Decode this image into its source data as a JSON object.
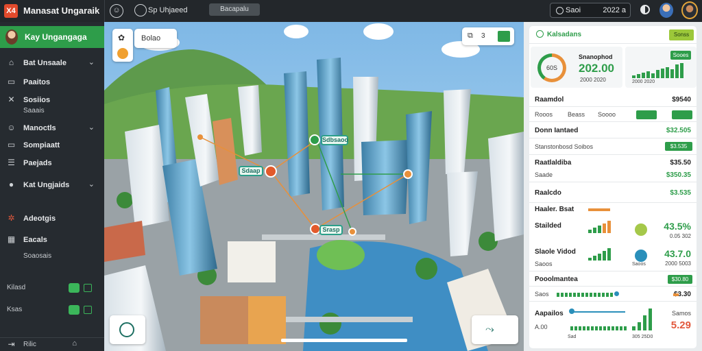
{
  "topbar": {
    "logo": "X4",
    "title": "Manasat Ungaraik",
    "location_label": "Sp Uhjaeed",
    "pill_label": "Bacapalu",
    "search_text": "Saoi",
    "search_value": "2022 a"
  },
  "sidebar": {
    "profile_name": "Kay Ungangaga",
    "items": [
      {
        "label": "Bat Unsaale",
        "icon": "home-icon"
      },
      {
        "label": "Paaitos",
        "icon": "document-icon"
      },
      {
        "label": "Sosiios",
        "icon": "tools-icon"
      },
      {
        "label": "Saaais",
        "icon": "tools-icon"
      },
      {
        "label": "Manoctls",
        "icon": "person-icon"
      },
      {
        "label": "Sompiaatt",
        "icon": "folder-icon"
      },
      {
        "label": "Paejads",
        "icon": "list-icon"
      },
      {
        "label": "Kat Ungjaids",
        "icon": "settings-icon"
      },
      {
        "label": "Adeotgis",
        "icon": "gear-icon"
      },
      {
        "label": "Eacals",
        "icon": "calendar-icon"
      },
      {
        "label": "Soaosais",
        "icon": ""
      },
      {
        "label": "Kilasd",
        "icon": ""
      },
      {
        "label": "Ksas",
        "icon": ""
      },
      {
        "label": "Rilic",
        "icon": "exit-icon"
      }
    ]
  },
  "map": {
    "top_left_label": "Bolao",
    "top_right_value": "3",
    "tags": [
      "Sdbsaoo",
      "Sdaap",
      "Srasp"
    ]
  },
  "panel": {
    "header_title": "Kalsadans",
    "header_button": "Sonss",
    "gauge_value": "60S",
    "stat_title": "Snanophod",
    "stat_value": "202.00",
    "stat_sub": "2000 2020",
    "spark_tag": "Sooes",
    "rows": [
      {
        "label": "Raamdol",
        "value": "$9540"
      },
      {
        "label": "Rooos",
        "label2": "Beass",
        "label3": "Soooo"
      },
      {
        "label": "Donn Iantaed",
        "value": "$32.505"
      },
      {
        "label": "Stanstonbosd Soibos",
        "value": "$3.535"
      },
      {
        "label": "Raatlaldiba",
        "value": "$35.50"
      },
      {
        "label": "Saade",
        "value": "$350.35"
      },
      {
        "label": "Raalcdo",
        "value": "$3.535"
      },
      {
        "label": "Haaler. Bsat"
      },
      {
        "label": "Stailded",
        "value": "43.5%",
        "sub": "0.05 302"
      },
      {
        "label": "Slaole Vidod",
        "value": "43.7.0",
        "sub": "2000 5003"
      },
      {
        "label": "Saoos",
        "sub": "Saoos"
      },
      {
        "label": "Pooolmantea",
        "value": "$30.80"
      },
      {
        "label": "Saos",
        "value": "$3.30"
      },
      {
        "label": "Aapailos",
        "value": "Samos"
      },
      {
        "label": "A.00",
        "value": "5.29"
      },
      {
        "label": "Sad",
        "sub": "305 25D0"
      }
    ]
  },
  "colors": {
    "accent": "#2e9d4a",
    "orange": "#e8903a",
    "sidebar": "#262b30",
    "topbar": "#23272b"
  }
}
